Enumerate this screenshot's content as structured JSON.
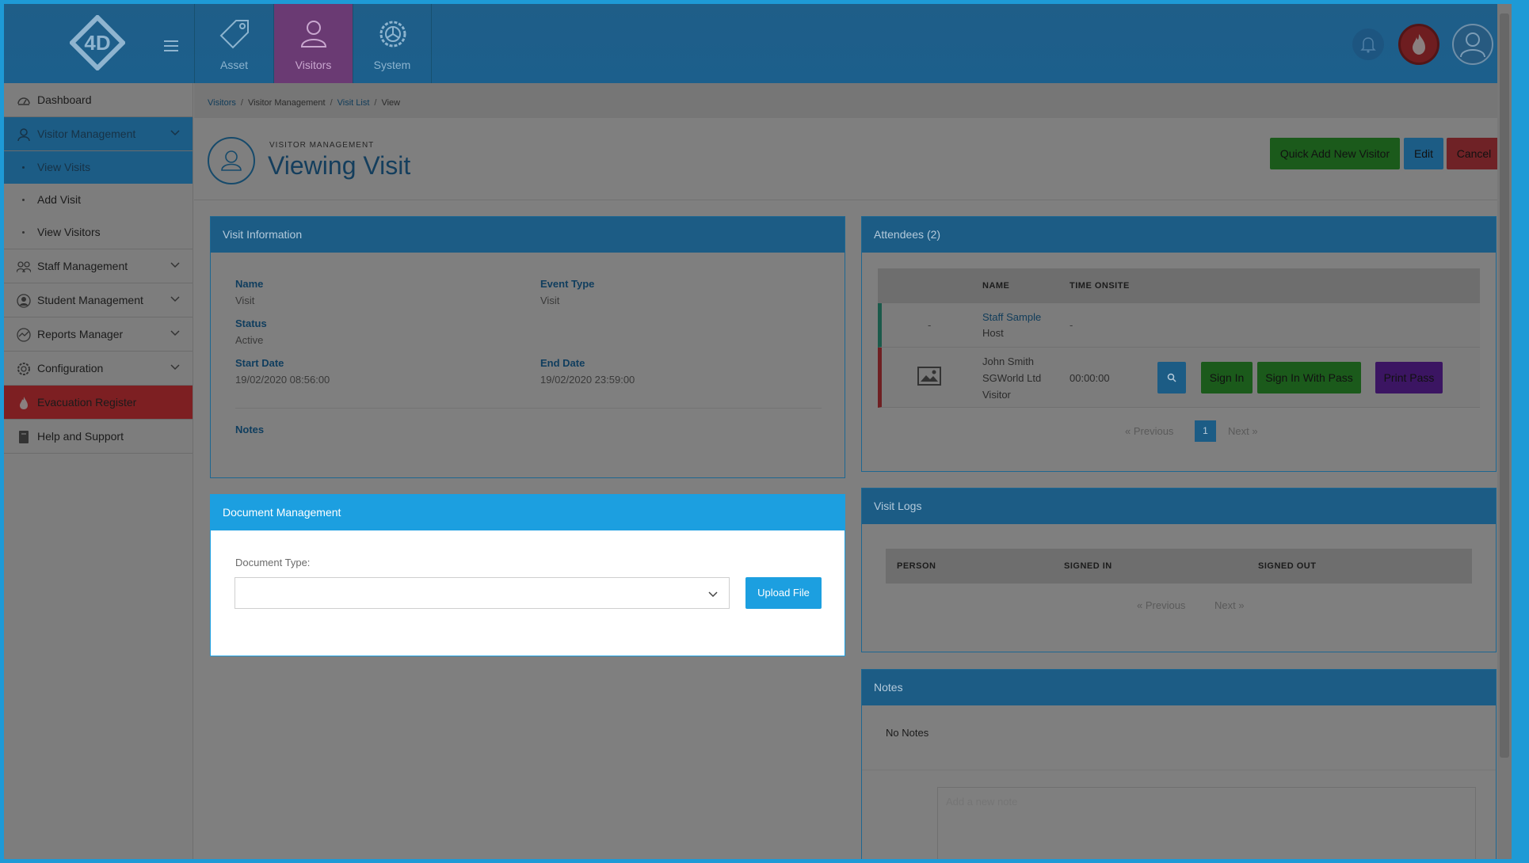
{
  "app": {
    "logo_text": "4D"
  },
  "topnav": {
    "modules": [
      {
        "label": "Asset",
        "icon": "tag-icon"
      },
      {
        "label": "Visitors",
        "icon": "person-icon"
      },
      {
        "label": "System",
        "icon": "gear-icon"
      }
    ]
  },
  "sidebar": {
    "items": [
      {
        "label": "Dashboard",
        "icon": "dashboard-icon"
      },
      {
        "label": "Visitor Management",
        "icon": "person-icon"
      },
      {
        "label": "View Visits"
      },
      {
        "label": "Add Visit"
      },
      {
        "label": "View Visitors"
      },
      {
        "label": "Staff Management",
        "icon": "staff-icon"
      },
      {
        "label": "Student Management",
        "icon": "student-icon"
      },
      {
        "label": "Reports Manager",
        "icon": "chart-icon"
      },
      {
        "label": "Configuration",
        "icon": "gear-icon"
      },
      {
        "label": "Evacuation Register",
        "icon": "flame-icon"
      },
      {
        "label": "Help and Support",
        "icon": "book-icon"
      }
    ]
  },
  "breadcrumb": [
    "Visitors",
    "Visitor Management",
    "Visit List",
    "View"
  ],
  "page": {
    "subtitle": "VISITOR MANAGEMENT",
    "title": "Viewing Visit",
    "buttons": {
      "quick_add": "Quick Add New Visitor",
      "edit": "Edit",
      "cancel": "Cancel"
    }
  },
  "visit_info": {
    "title": "Visit Information",
    "name_label": "Name",
    "name_value": "Visit",
    "event_type_label": "Event Type",
    "event_type_value": "Visit",
    "status_label": "Status",
    "status_value": "Active",
    "start_label": "Start Date",
    "start_value": "19/02/2020 08:56:00",
    "end_label": "End Date",
    "end_value": "19/02/2020 23:59:00",
    "notes_label": "Notes"
  },
  "documents": {
    "title": "Document Management",
    "type_label": "Document Type:",
    "type_value": "",
    "upload_label": "Upload File"
  },
  "attendees": {
    "title": "Attendees (2)",
    "columns": [
      "NAME",
      "TIME ONSITE"
    ],
    "rows": [
      {
        "col1": "-",
        "name": "Staff Sample",
        "role": "Host",
        "time": "-"
      },
      {
        "name": "John Smith",
        "company": "SGWorld Ltd",
        "role": "Visitor",
        "time": "00:00:00"
      }
    ],
    "buttons": {
      "sign_in": "Sign In",
      "sign_in_pass": "Sign In With Pass",
      "print_pass": "Print Pass"
    },
    "pager": {
      "prev": "« Previous",
      "page": "1",
      "next": "Next »"
    }
  },
  "visit_logs": {
    "title": "Visit Logs",
    "columns": [
      "PERSON",
      "SIGNED IN",
      "SIGNED OUT"
    ],
    "pager": {
      "prev": "« Previous",
      "next": "Next »"
    }
  },
  "notes": {
    "title": "Notes",
    "empty_text": "No Notes",
    "placeholder": "Add a new note"
  },
  "colors": {
    "frame": "#1e9ad6",
    "header": "#1c5c85",
    "visitors_tab": "#6a3a73",
    "evacuation": "#7d1f22",
    "documents_header": "#1c9fe0"
  }
}
